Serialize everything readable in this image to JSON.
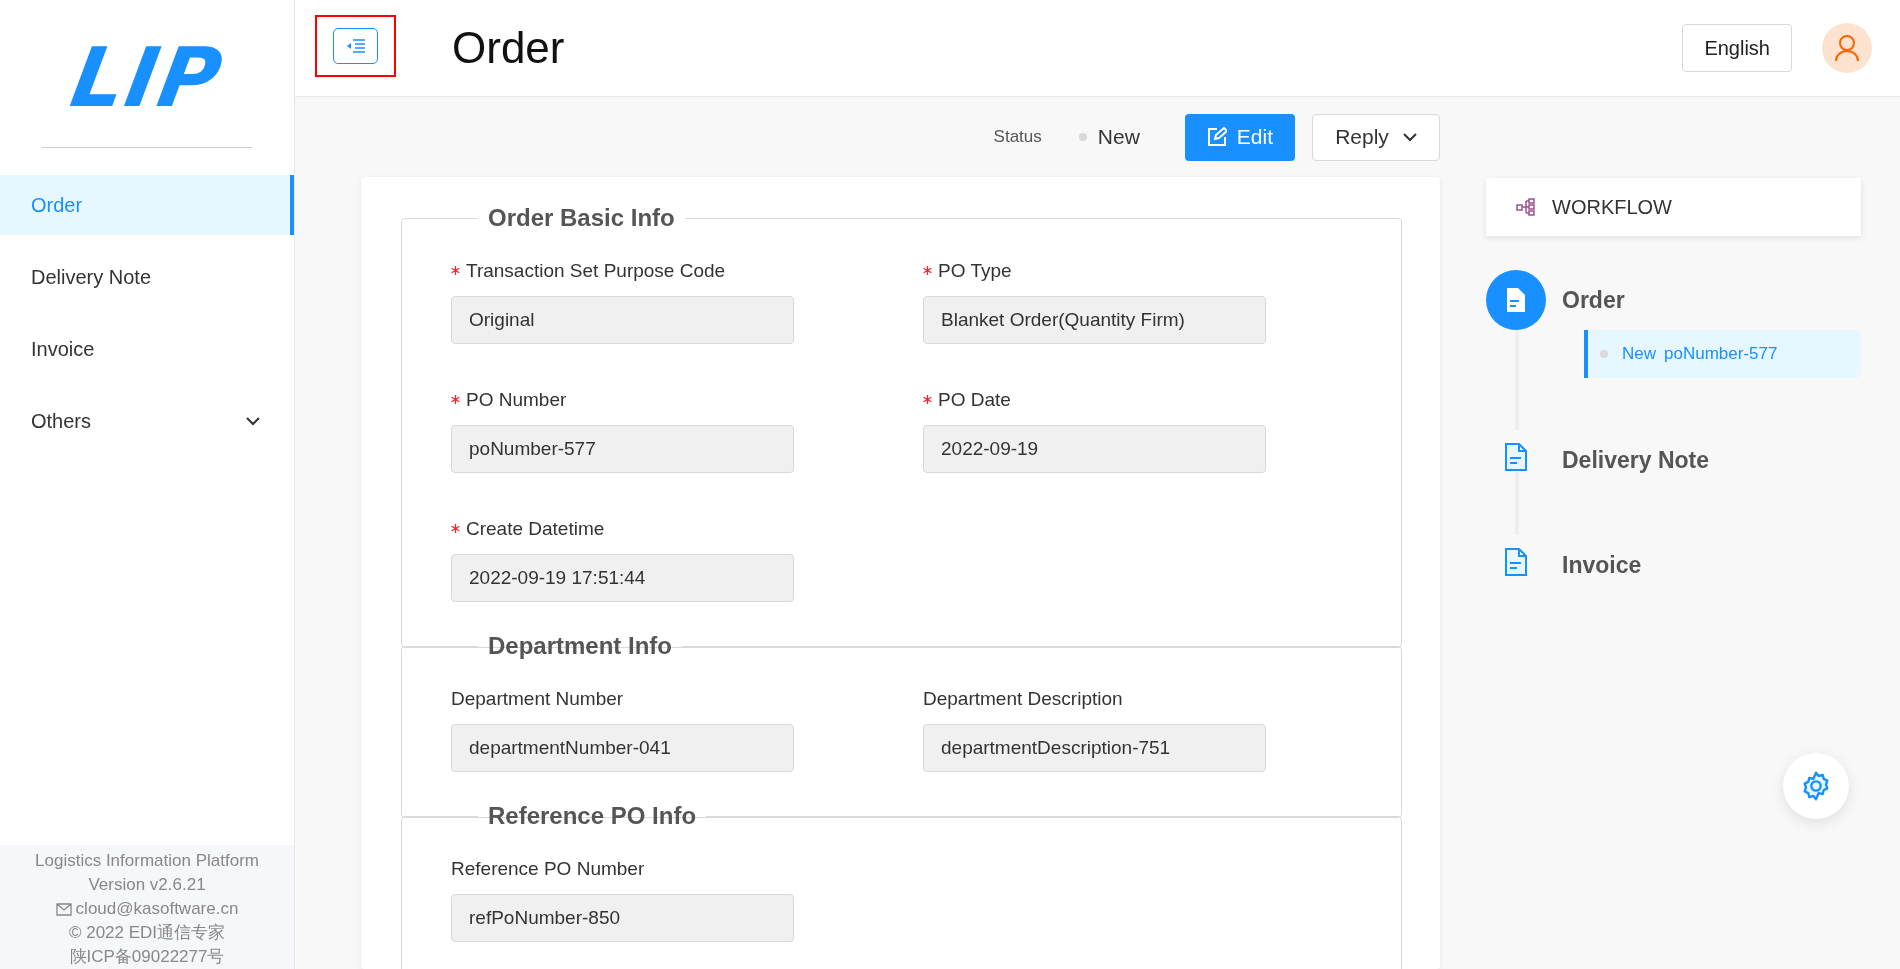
{
  "logo": {
    "text": "LIP"
  },
  "sidebar": {
    "items": [
      {
        "label": "Order",
        "kind": "item",
        "selected": true
      },
      {
        "label": "Delivery Note",
        "kind": "item",
        "selected": false
      },
      {
        "label": "Invoice",
        "kind": "item",
        "selected": false
      },
      {
        "label": "Others",
        "kind": "submenu",
        "selected": false,
        "expanded": false
      }
    ],
    "footer": {
      "platform": "Logistics Information Platform",
      "version": "Version v2.6.21",
      "email": "cloud@kasoftware.cn",
      "copyright": "© 2022 EDI通信专家",
      "icp": "陕ICP备09022277号"
    }
  },
  "header": {
    "title": "Order",
    "language": "English"
  },
  "toolbar": {
    "status_label": "Status",
    "status": "New",
    "edit": "Edit",
    "reply": "Reply"
  },
  "sections": [
    {
      "title": "Order Basic Info",
      "fields": [
        {
          "label": "Transaction Set Purpose Code",
          "required": true,
          "value": "Original"
        },
        {
          "label": "PO Type",
          "required": true,
          "value": "Blanket Order(Quantity Firm)"
        },
        {
          "label": "PO Number",
          "required": true,
          "value": "poNumber-577"
        },
        {
          "label": "PO Date",
          "required": true,
          "value": "2022-09-19"
        },
        {
          "label": "Create Datetime",
          "required": true,
          "value": "2022-09-19 17:51:44"
        }
      ]
    },
    {
      "title": "Department Info",
      "fields": [
        {
          "label": "Department Number",
          "required": false,
          "value": "departmentNumber-041"
        },
        {
          "label": "Department Description",
          "required": false,
          "value": "departmentDescription-751"
        }
      ]
    },
    {
      "title": "Reference PO Info",
      "fields": [
        {
          "label": "Reference PO Number",
          "required": false,
          "value": "refPoNumber-850"
        }
      ]
    }
  ],
  "workflow": {
    "title": "WORKFLOW",
    "steps": [
      {
        "label": "Order",
        "selected": true,
        "entries": [
          {
            "status": "New",
            "text": "poNumber-577"
          }
        ]
      },
      {
        "label": "Delivery Note",
        "selected": false
      },
      {
        "label": "Invoice",
        "selected": false
      }
    ]
  }
}
